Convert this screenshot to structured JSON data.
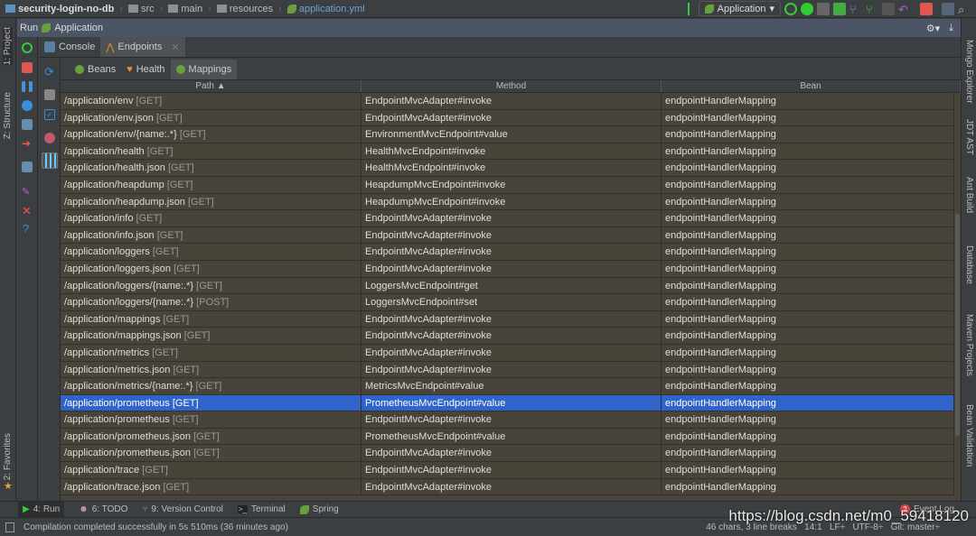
{
  "breadcrumb": [
    "security-login-no-db",
    "src",
    "main",
    "resources",
    "application.yml"
  ],
  "run_config": "Application",
  "run_header": {
    "label": "Run",
    "config": "Application"
  },
  "tabs": [
    "Console",
    "Endpoints"
  ],
  "subtabs": [
    "Beans",
    "Health",
    "Mappings"
  ],
  "columns": [
    "Path ▲",
    "Method",
    "Bean"
  ],
  "rows": [
    [
      "/application/env",
      "[GET]",
      "EndpointMvcAdapter#invoke",
      "endpointHandlerMapping"
    ],
    [
      "/application/env.json",
      "[GET]",
      "EndpointMvcAdapter#invoke",
      "endpointHandlerMapping"
    ],
    [
      "/application/env/{name:.*}",
      "[GET]",
      "EnvironmentMvcEndpoint#value",
      "endpointHandlerMapping"
    ],
    [
      "/application/health",
      "[GET]",
      "HealthMvcEndpoint#invoke",
      "endpointHandlerMapping"
    ],
    [
      "/application/health.json",
      "[GET]",
      "HealthMvcEndpoint#invoke",
      "endpointHandlerMapping"
    ],
    [
      "/application/heapdump",
      "[GET]",
      "HeapdumpMvcEndpoint#invoke",
      "endpointHandlerMapping"
    ],
    [
      "/application/heapdump.json",
      "[GET]",
      "HeapdumpMvcEndpoint#invoke",
      "endpointHandlerMapping"
    ],
    [
      "/application/info",
      "[GET]",
      "EndpointMvcAdapter#invoke",
      "endpointHandlerMapping"
    ],
    [
      "/application/info.json",
      "[GET]",
      "EndpointMvcAdapter#invoke",
      "endpointHandlerMapping"
    ],
    [
      "/application/loggers",
      "[GET]",
      "EndpointMvcAdapter#invoke",
      "endpointHandlerMapping"
    ],
    [
      "/application/loggers.json",
      "[GET]",
      "EndpointMvcAdapter#invoke",
      "endpointHandlerMapping"
    ],
    [
      "/application/loggers/{name:.*}",
      "[GET]",
      "LoggersMvcEndpoint#get",
      "endpointHandlerMapping"
    ],
    [
      "/application/loggers/{name:.*}",
      "[POST]",
      "LoggersMvcEndpoint#set",
      "endpointHandlerMapping"
    ],
    [
      "/application/mappings",
      "[GET]",
      "EndpointMvcAdapter#invoke",
      "endpointHandlerMapping"
    ],
    [
      "/application/mappings.json",
      "[GET]",
      "EndpointMvcAdapter#invoke",
      "endpointHandlerMapping"
    ],
    [
      "/application/metrics",
      "[GET]",
      "EndpointMvcAdapter#invoke",
      "endpointHandlerMapping"
    ],
    [
      "/application/metrics.json",
      "[GET]",
      "EndpointMvcAdapter#invoke",
      "endpointHandlerMapping"
    ],
    [
      "/application/metrics/{name:.*}",
      "[GET]",
      "MetricsMvcEndpoint#value",
      "endpointHandlerMapping"
    ],
    [
      "/application/prometheus",
      "[GET]",
      "PrometheusMvcEndpoint#value",
      "endpointHandlerMapping"
    ],
    [
      "/application/prometheus",
      "[GET]",
      "EndpointMvcAdapter#invoke",
      "endpointHandlerMapping"
    ],
    [
      "/application/prometheus.json",
      "[GET]",
      "PrometheusMvcEndpoint#value",
      "endpointHandlerMapping"
    ],
    [
      "/application/prometheus.json",
      "[GET]",
      "EndpointMvcAdapter#invoke",
      "endpointHandlerMapping"
    ],
    [
      "/application/trace",
      "[GET]",
      "EndpointMvcAdapter#invoke",
      "endpointHandlerMapping"
    ],
    [
      "/application/trace.json",
      "[GET]",
      "EndpointMvcAdapter#invoke",
      "endpointHandlerMapping"
    ]
  ],
  "selected_row": 18,
  "left_strip": [
    "1: Project",
    "Z: Structure",
    "2: Favorites"
  ],
  "right_strip": [
    "Mongo Explorer",
    "JDT AST",
    "Ant Build",
    "Database",
    "Maven Projects",
    "Bean Validation"
  ],
  "bottom_tools": [
    "4: Run",
    "6: TODO",
    "9: Version Control",
    "Terminal",
    "Spring"
  ],
  "event_log": {
    "label": "Event Log",
    "count": "2"
  },
  "status": {
    "message": "Compilation completed successfully in 5s 510ms (36 minutes ago)",
    "right": "46 chars, 3 line breaks   14:1   LF÷   UTF-8÷   Git: master÷"
  },
  "watermark": "https://blog.csdn.net/m0_59418120",
  "colors": {
    "row_bg": "#48443a",
    "selected": "#2f65ca",
    "run_header": "#4b5566"
  }
}
